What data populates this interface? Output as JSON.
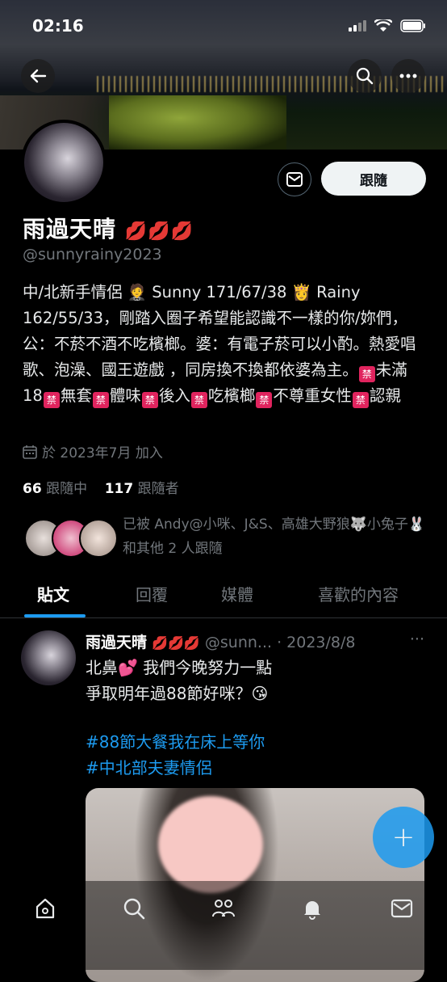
{
  "status_bar": {
    "time": "02:16"
  },
  "profile": {
    "name": "雨過天晴",
    "name_emoji": "💋💋💋",
    "handle": "@sunnyrainy2023",
    "follow_label": "跟隨",
    "bio_parts": [
      "中/北新手情侶 🤵 Sunny 171/67/38 👸 Rainy 162/55/33，剛踏入圈子希望能認識不一樣的你/妳們，公：不菸不酒不吃檳榔。婆：有電子菸可以小酌。熱愛唱歌、泡澡、國王遊戲 ，同房換不換都依婆為主。",
      "未滿18",
      "無套",
      "體味",
      "後入",
      "吃檳榔",
      "不尊重女性",
      "認親"
    ],
    "ban_glyph": "禁",
    "joined": "於 2023年7月 加入",
    "following_count": "66",
    "following_label": "跟隨中",
    "followers_count": "117",
    "followers_label": "跟隨者",
    "followed_by": "已被 Andy@小咪、J&S、高雄大野狼🐺小兔子🐰 和其他 2 人跟隨"
  },
  "tabs": [
    "貼文",
    "回覆",
    "媒體",
    "喜歡的內容"
  ],
  "post": {
    "name": "雨過天晴",
    "name_emoji": "💋💋💋",
    "handle": "@sunn...",
    "date": "· 2023/8/8",
    "more": "···",
    "line1": "北鼻💕 我們今晚努力一點",
    "line2": "爭取明年過88節好咪？😘",
    "tag1": "#88節大餐我在床上等你",
    "tag2": "#中北部夫妻情侶"
  },
  "fab_label": "+",
  "icons": [
    "back-arrow-icon",
    "search-icon",
    "more-icon",
    "mail-icon",
    "calendar-icon",
    "home-icon",
    "search-icon",
    "communities-icon",
    "bell-icon",
    "mail-icon"
  ]
}
